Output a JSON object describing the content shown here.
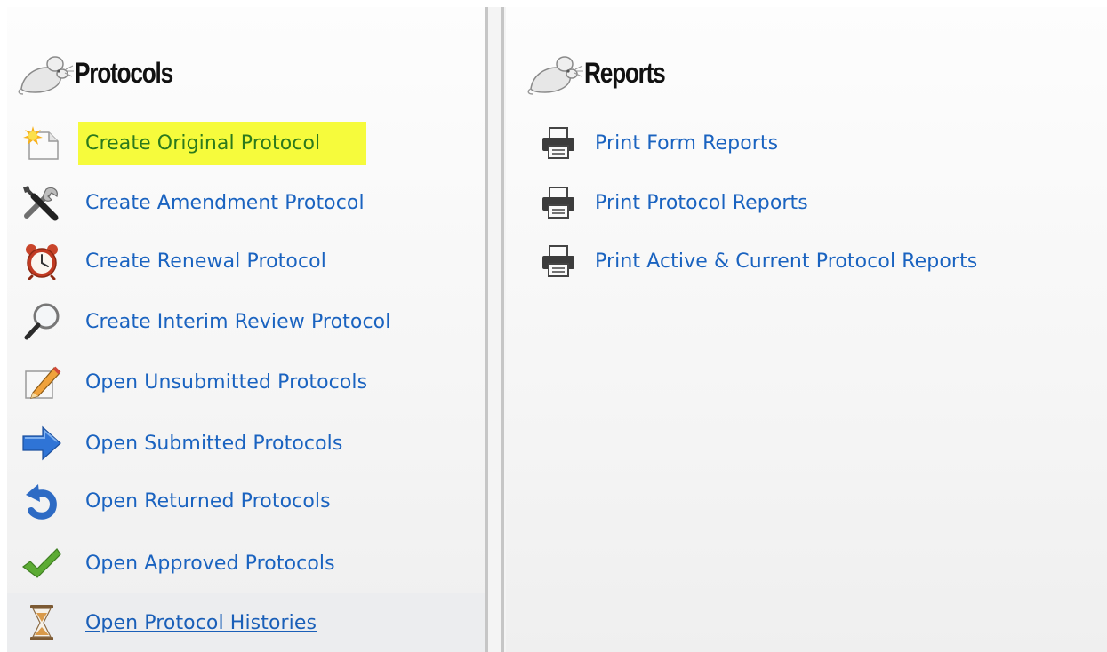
{
  "protocols": {
    "title": "Protocols",
    "items": [
      {
        "label": "Create Original Protocol",
        "icon": "new-document-icon",
        "highlighted": true
      },
      {
        "label": "Create Amendment Protocol",
        "icon": "tools-icon"
      },
      {
        "label": "Create Renewal Protocol",
        "icon": "alarm-clock-icon"
      },
      {
        "label": "Create Interim Review Protocol",
        "icon": "magnifier-icon"
      },
      {
        "label": "Open Unsubmitted Protocols",
        "icon": "edit-pencil-icon"
      },
      {
        "label": "Open Submitted Protocols",
        "icon": "arrow-right-icon"
      },
      {
        "label": "Open Returned Protocols",
        "icon": "undo-icon"
      },
      {
        "label": "Open Approved Protocols",
        "icon": "checkmark-icon"
      },
      {
        "label": "Open Protocol Histories",
        "icon": "hourglass-icon",
        "hovered": true
      }
    ]
  },
  "reports": {
    "title": "Reports",
    "items": [
      {
        "label": "Print Form Reports",
        "icon": "printer-icon"
      },
      {
        "label": "Print Protocol Reports",
        "icon": "printer-icon"
      },
      {
        "label": "Print Active & Current Protocol Reports",
        "icon": "printer-icon"
      }
    ]
  },
  "colors": {
    "link": "#1a63c0",
    "highlight_background": "#f6fb3c",
    "highlight_text": "#2c7a1c",
    "hover_background": "#ecedef"
  }
}
